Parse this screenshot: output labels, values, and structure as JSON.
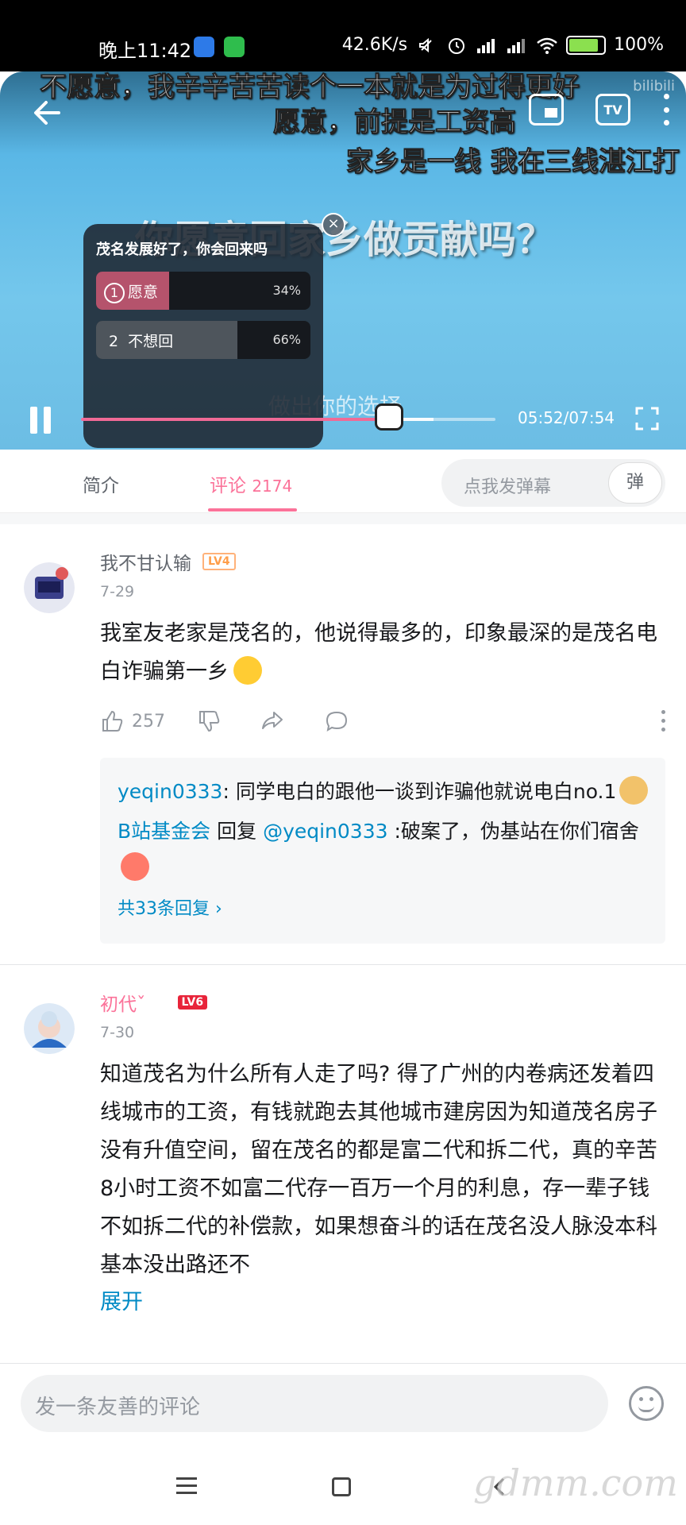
{
  "status_bar": {
    "time": "晚上11:42",
    "speed": "42.6K/s",
    "battery_text": "100%",
    "icons": [
      "bluetooth-app-icon",
      "wechat-icon",
      "mute-icon",
      "alarm-icon",
      "signal-hd-1-icon",
      "signal-hd-2-icon",
      "wifi-icon",
      "battery-icon"
    ]
  },
  "video": {
    "danmaku": [
      "不愿意，我辛辛苦苦读个一本就是为过得更好",
      "愿意，前提是工资高",
      "家乡是一线  我在三线湛江打"
    ],
    "question_overlay": "你愿意回家乡做贡献吗？",
    "hint_overlay": "做出你的选择",
    "watermark": "bilibili",
    "tv_label": "TV",
    "poll": {
      "title": "茂名发展好了，你会回来吗",
      "options": [
        {
          "num": "1",
          "label": "愿意",
          "pct": "34%",
          "value": 0.34
        },
        {
          "num": "2",
          "label": "不想回",
          "pct": "66%",
          "value": 0.66
        }
      ]
    },
    "progress": {
      "played_fraction": 0.743,
      "buffered_fraction": 0.85
    },
    "timecode": "05:52/07:54"
  },
  "tabs": {
    "intro": "简介",
    "comments": "评论",
    "comment_count": "2174",
    "danmaku_placeholder": "点我发弹幕",
    "danmaku_btn": "弹"
  },
  "comments": [
    {
      "user": "我不甘认输",
      "level": "LV4",
      "date": "7-29",
      "text": "我室友老家是茂名的，他说得最多的，印象最深的是茂名电白诈骗第一乡",
      "likes": "257",
      "replies": [
        {
          "user": "yeqin0333",
          "sep": ": ",
          "text": "同学电白的跟他一谈到诈骗他就说电白no.1"
        },
        {
          "user": "B站基金会",
          "mid": " 回复 ",
          "target": "@yeqin0333",
          "text": " :破案了，伪基站在你们宿舍"
        }
      ],
      "more_replies": "共33条回复"
    },
    {
      "user": "初代ˇ",
      "level": "LV6",
      "date": "7-30",
      "text": "知道茂名为什么所有人走了吗? 得了广州的内卷病还发着四线城市的工资，有钱就跑去其他城市建房因为知道茂名房子没有升值空间，留在茂名的都是富二代和拆二代，真的辛苦8小时工资不如富二代存一百万一个月的利息，存一辈子钱不如拆二代的补偿款，如果想奋斗的话在茂名没人脉没本科基本没出路还不",
      "expand": "展开"
    }
  ],
  "bottom_input": {
    "placeholder": "发一条友善的评论"
  },
  "watermark_corner": "gdmm.com",
  "colors": {
    "accent": "#fb7299",
    "link": "#008ac5",
    "poll_yes": "#b5536c"
  }
}
